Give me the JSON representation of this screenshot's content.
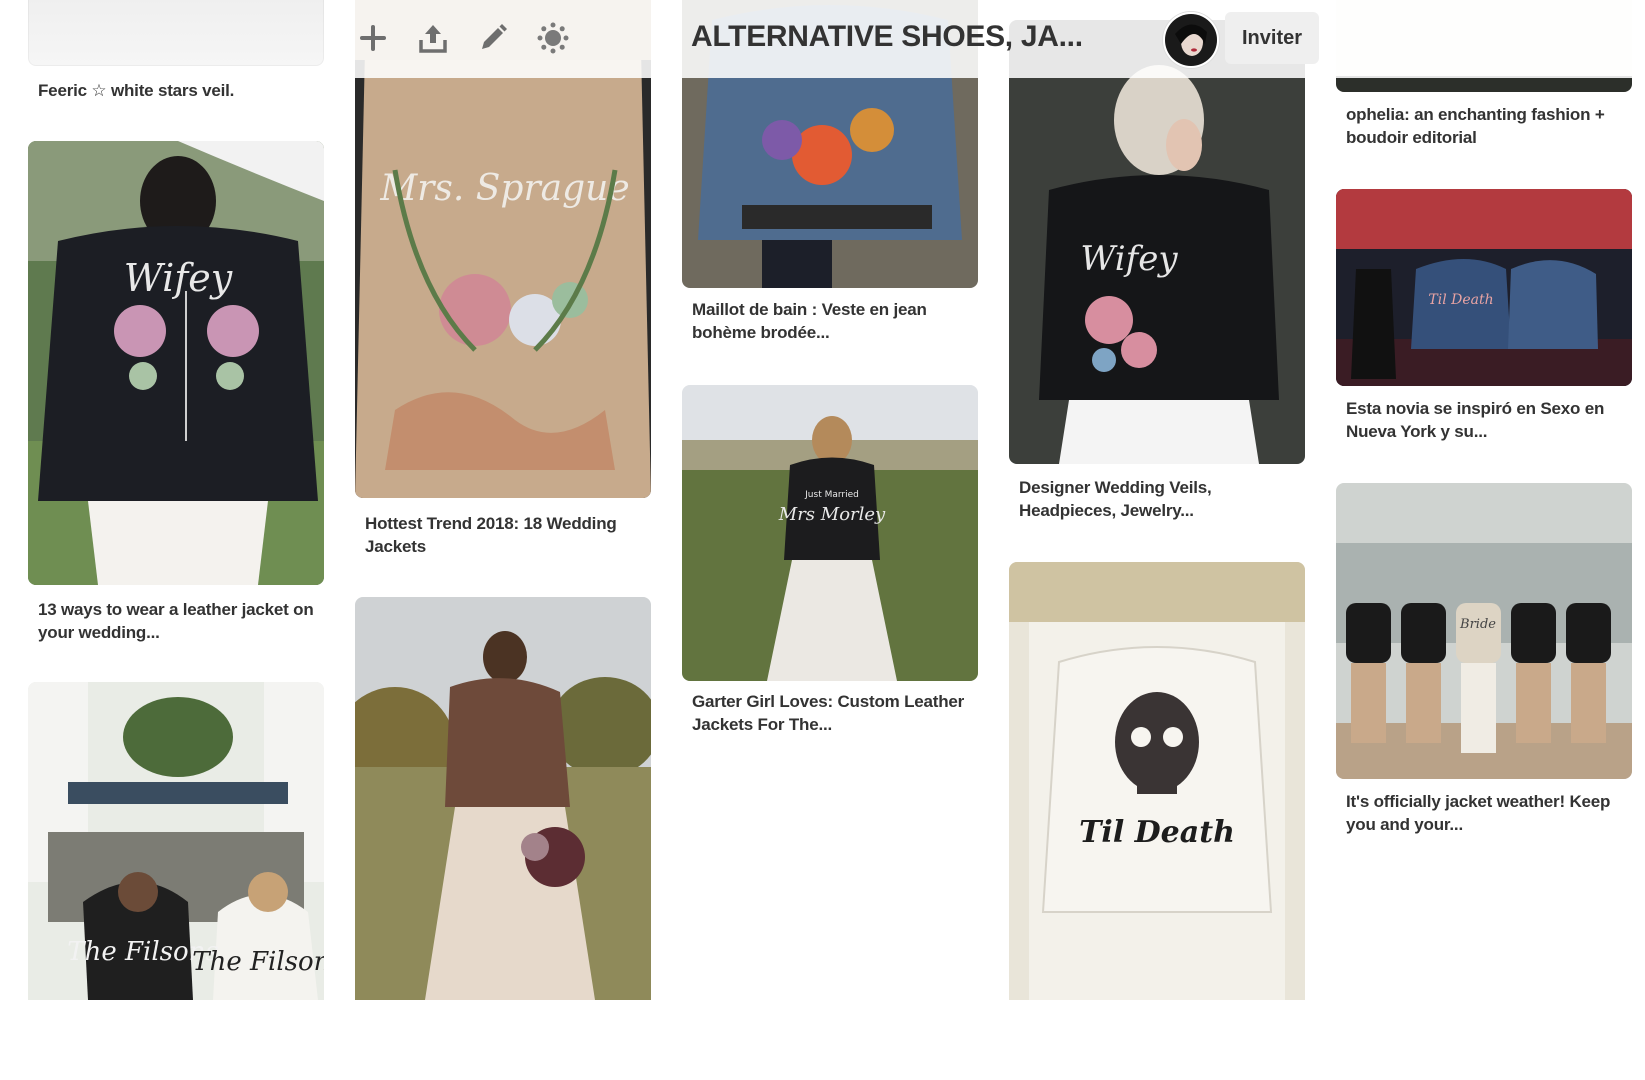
{
  "header": {
    "board_title": "ALTERNATIVE SHOES, JA...",
    "invite_label": "Inviter",
    "tools": [
      "add-icon",
      "share-icon",
      "edit-icon",
      "settings-icon"
    ]
  },
  "pins": {
    "col1": [
      {
        "caption": "Feeric ☆ white stars veil."
      },
      {
        "caption": "13 ways to wear a leather jacket on your wedding..."
      },
      {
        "caption": ""
      }
    ],
    "col2": [
      {
        "caption": "Hottest Trend 2018: 18 Wedding Jackets"
      },
      {
        "caption": ""
      }
    ],
    "col3": [
      {
        "caption": "Maillot de bain : Veste en jean bohème brodée..."
      },
      {
        "caption": "Garter Girl Loves: Custom Leather Jackets For The..."
      }
    ],
    "col4": [
      {
        "caption": "Designer Wedding Veils, Headpieces, Jewelry..."
      },
      {
        "caption": ""
      }
    ],
    "col5": [
      {
        "caption": "ophelia: an enchanting fashion + boudoir editorial"
      },
      {
        "caption": "Esta novia se inspiró en Sexo en Nueva York y su..."
      },
      {
        "caption": "It's officially jacket weather! Keep you and your..."
      }
    ]
  },
  "image_text": {
    "wifey": "Wifey",
    "mrs_sprague": "Mrs. Sprague",
    "just_married": "Just Married",
    "mrs_morley": "Mrs Morley",
    "til_death": "Til Death",
    "the_filsons": "The Filsons",
    "bride": "Bride"
  },
  "colors": {
    "text": "#333333",
    "toolbar_icon": "#6e6e6e",
    "invite_bg": "#efefef"
  }
}
